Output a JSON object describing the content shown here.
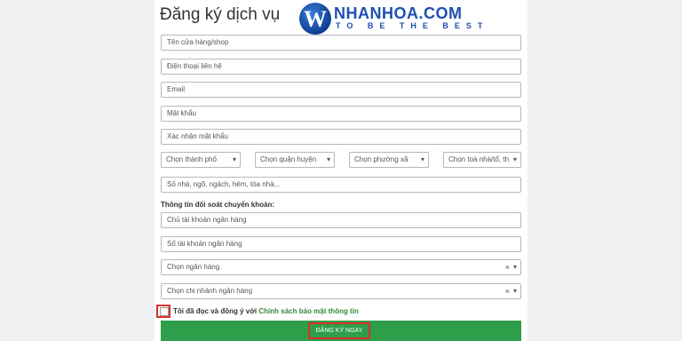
{
  "page": {
    "title": "Đăng ký dịch vụ"
  },
  "logo": {
    "letter": "W",
    "name": "NHANHOA.COM",
    "tagline": "TO BE THE BEST"
  },
  "form": {
    "shop_name_placeholder": "Tên cửa hàng/shop",
    "phone_placeholder": "Điện thoại liên hệ",
    "email_placeholder": "Email",
    "password_placeholder": "Mật khẩu",
    "confirm_password_placeholder": "Xác nhận mật khẩu",
    "city_select": "Chọn thành phố",
    "district_select": "Chọn quận huyện",
    "ward_select": "Chọn phường xã",
    "building_select": "Chọn toà nhà/tổ, th",
    "address_placeholder": "Số nhà, ngõ, ngách, hẻm, tòa nhà...",
    "bank_section_label": "Thông tin đối soát chuyển khoản:",
    "account_holder_placeholder": "Chủ tài khoản ngân hàng",
    "account_number_placeholder": "Số tài khoản ngân hàng",
    "bank_select": "Chọn ngân hàng",
    "branch_select": "Chọn chi nhánh ngân hàng",
    "agree_text": "Tôi đã đọc và đồng ý với",
    "policy_link": "Chính sách bảo mật thông tin",
    "submit_label": "ĐĂNG KÝ NGAY"
  },
  "icons": {
    "chevron": "chevron-down-icon",
    "clear": "clear-icon"
  },
  "colors": {
    "brand_blue": "#1f4fb1",
    "submit_green": "#2e9e4a",
    "highlight_red": "#d9302b",
    "link_green": "#2e8b3a"
  }
}
